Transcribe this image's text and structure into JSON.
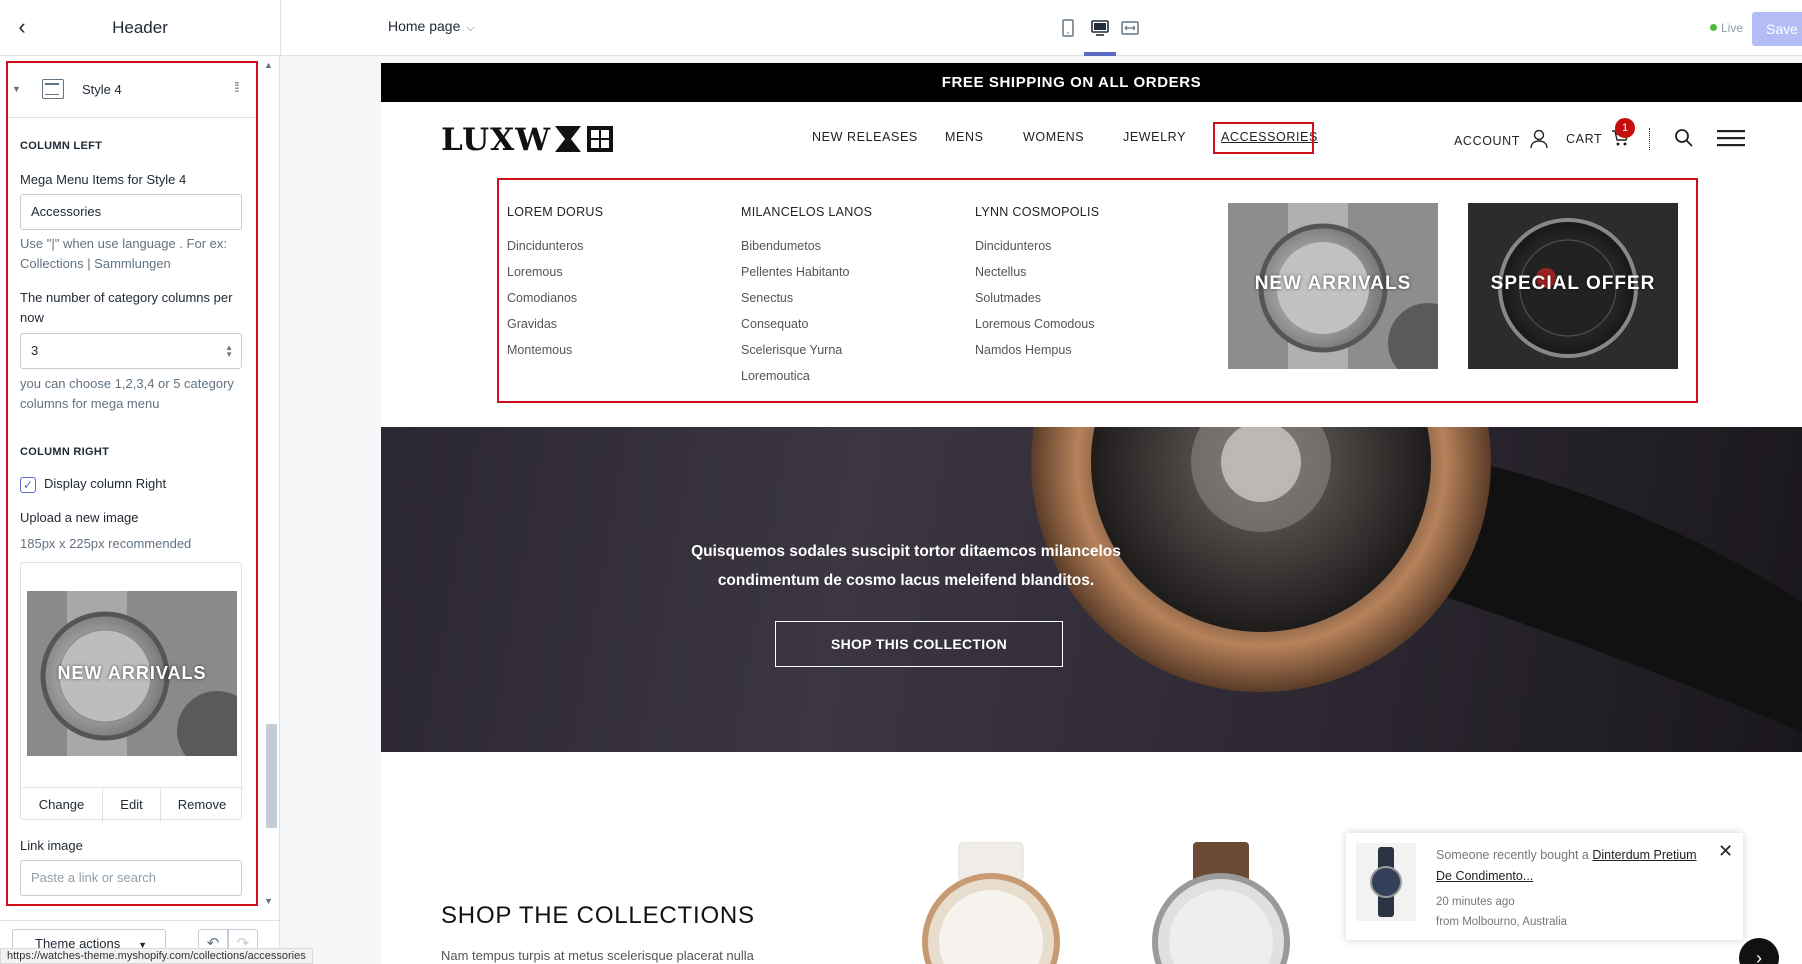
{
  "topbar": {
    "back_glyph": "‹",
    "panel_title": "Header",
    "page_select": "Home page",
    "live_label": "Live",
    "save_label": "Save",
    "accent": "#5c6ac4"
  },
  "sidebar": {
    "block_name": "Style 4",
    "column_left_heading": "COLUMN LEFT",
    "mega_menu_label": "Mega Menu Items for Style 4",
    "mega_menu_value": "Accessories",
    "mega_menu_help": "Use \"|\" when use language . For ex: Collections | Sammlungen",
    "columns_label": "The number of category columns per now",
    "columns_value": "3",
    "columns_help": "you can choose 1,2,3,4 or 5 category columns for mega menu",
    "column_right_heading": "COLUMN RIGHT",
    "display_right_label": "Display column Right",
    "display_right_checked": true,
    "upload_label": "Upload a new image",
    "upload_help": "185px x 225px recommended",
    "image_caption": "NEW ARRIVALS",
    "btn_change": "Change",
    "btn_edit": "Edit",
    "btn_remove": "Remove",
    "link_label": "Link image",
    "link_placeholder": "Paste a link or search",
    "theme_actions": "Theme actions",
    "highlight_color": "#d0101b"
  },
  "status_url": "https://watches-theme.myshopify.com/collections/accessories",
  "store": {
    "announcement": "FREE SHIPPING ON ALL ORDERS",
    "logo_text": "LUXW",
    "nav": [
      "NEW RELEASES",
      "MENS",
      "WOMENS",
      "JEWELRY",
      "ACCESSORIES"
    ],
    "account": "ACCOUNT",
    "cart": "CART",
    "cart_count": "1",
    "mega": {
      "columns": [
        {
          "heading": "LOREM DORUS",
          "links": [
            "Dincidunteros",
            "Loremous",
            "Comodianos",
            "Gravidas",
            "Montemous"
          ]
        },
        {
          "heading": "MILANCELOS LANOS",
          "links": [
            "Bibendumetos",
            "Pellentes Habitanto",
            "Senectus",
            "Consequato",
            "Scelerisque Yurna",
            "Loremoutica"
          ]
        },
        {
          "heading": "LYNN COSMOPOLIS",
          "links": [
            "Dincidunteros",
            "Nectellus",
            "Solutmades",
            "Loremous Comodous",
            "Namdos Hempus"
          ]
        }
      ],
      "images": [
        "NEW ARRIVALS",
        "SPECIAL OFFER"
      ]
    },
    "hero_text": "Quisquemos sodales suscipit tortor ditaemcos milancelos condimentum de cosmo lacus meleifend blanditos.",
    "hero_button": "SHOP THIS COLLECTION",
    "collections_title": "SHOP THE COLLECTIONS",
    "collections_text": "Nam tempus turpis at metus scelerisque placerat nulla",
    "popup": {
      "prefix": "Someone recently bought a",
      "product": "Dinterdum Pretium De Condimento...",
      "time": "20 minutes ago",
      "from": "from Molbourno, Australia"
    }
  }
}
